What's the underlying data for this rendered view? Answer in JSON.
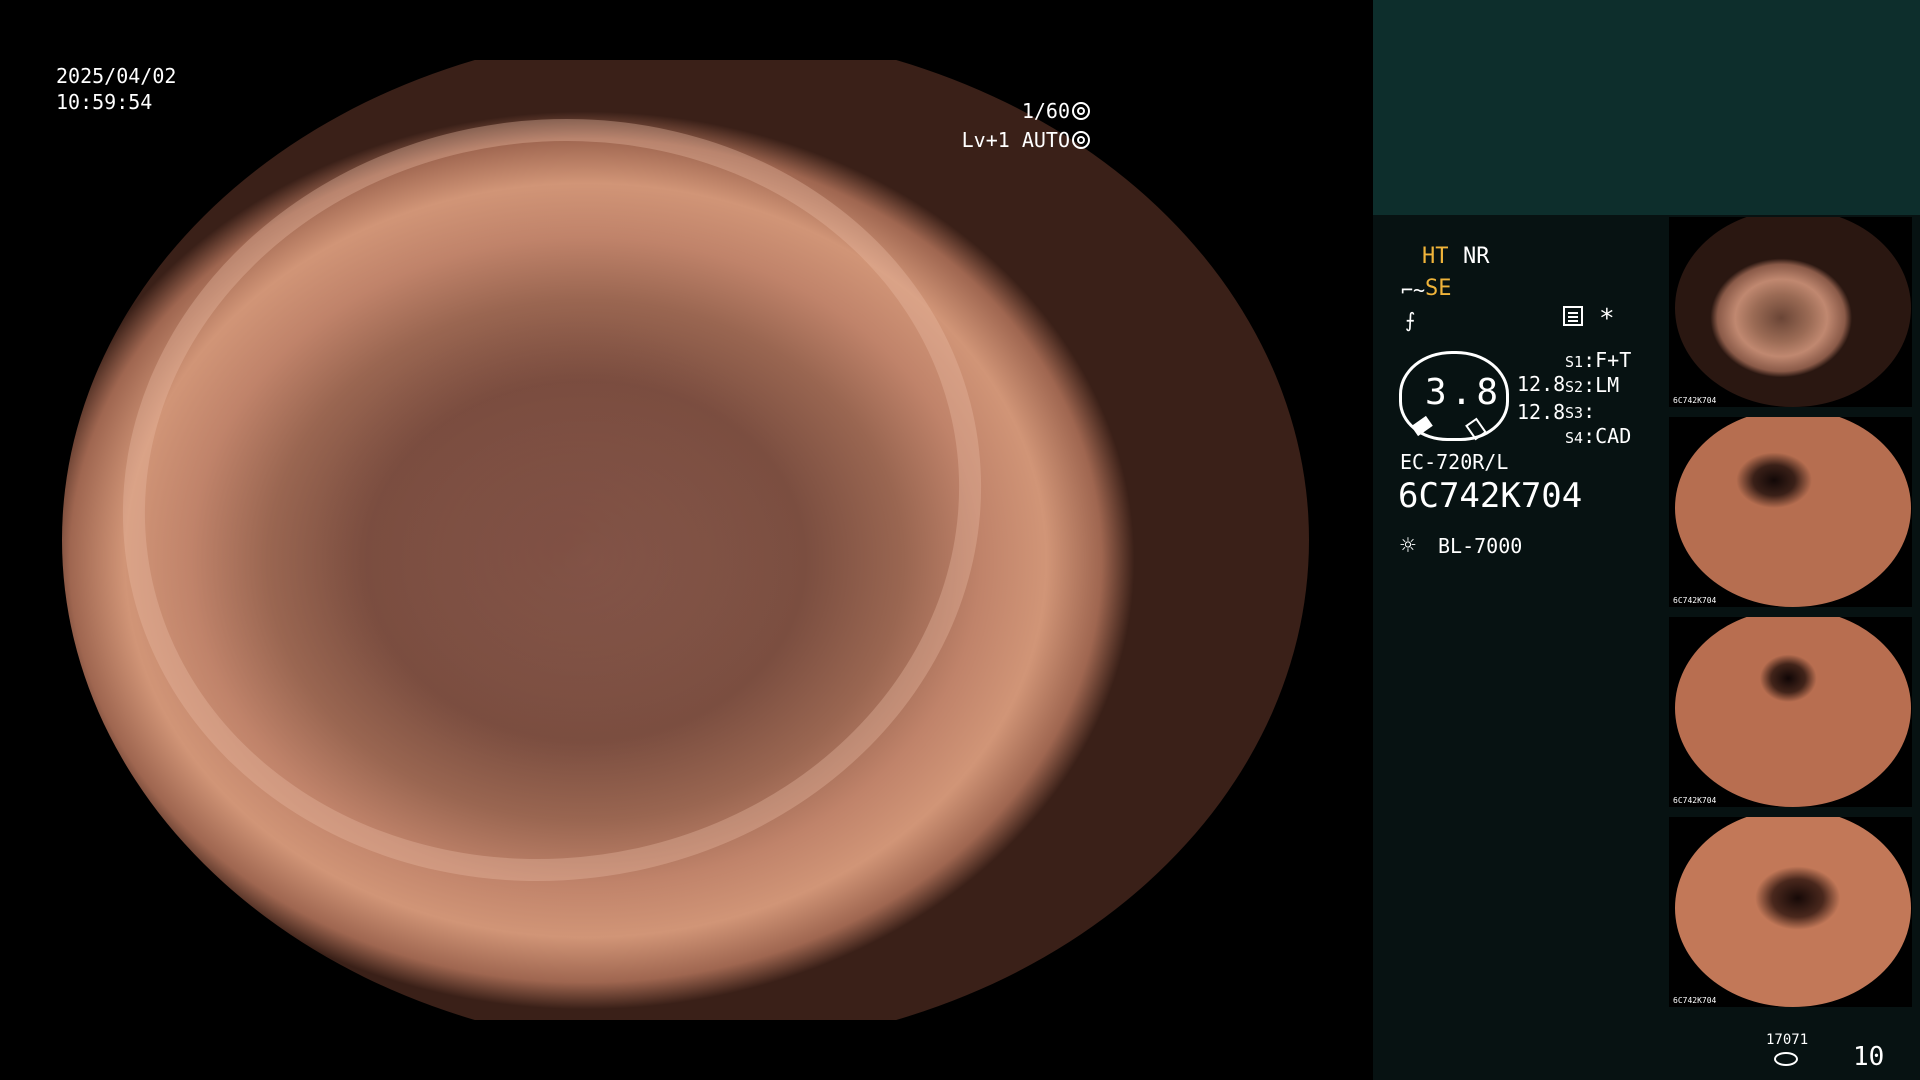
{
  "osd": {
    "date": "2025/04/02",
    "time": "10:59:54",
    "shutter": "1/60",
    "level": "Lv+1 AUTO"
  },
  "status": {
    "ht": "HT",
    "nr": "NR",
    "se": "SE",
    "star": "*",
    "gauge_value": "3.8",
    "values": [
      "12.8",
      "12.8"
    ],
    "switches": [
      {
        "key": "S1",
        "value": "F+T"
      },
      {
        "key": "S2",
        "value": "LM"
      },
      {
        "key": "S3",
        "value": ""
      },
      {
        "key": "S4",
        "value": "CAD"
      }
    ]
  },
  "scope": {
    "model": "EC-720R/L",
    "serial": "6C742K704",
    "light_source": "BL-7000"
  },
  "thumbnails": {
    "caption": "6C742K704"
  },
  "storage": {
    "label": "17071",
    "count": "10"
  },
  "colors": {
    "sidebar_bg": "#071212",
    "sidebar_top": "#0d2e2c",
    "accent": "#f0b43a"
  },
  "icons": [
    "shutter-icon",
    "auto-iris-icon",
    "structure-enhancement-icon",
    "color-enhancement-icon",
    "menu-icon",
    "lamp-icon",
    "storage-disk-icon"
  ]
}
